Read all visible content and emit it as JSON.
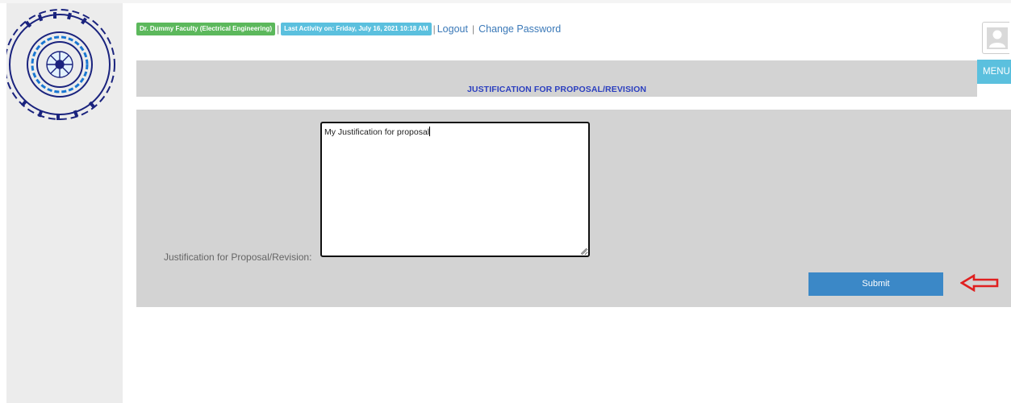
{
  "header": {
    "user_badge": "Dr. Dummy Faculty (Electrical Engineering)",
    "activity_badge": "Last Activity on: Friday, July 16, 2021 10:18 AM",
    "separator": "|",
    "logout_label": "Logout",
    "link_separator": "|",
    "change_password_label": "Change Password",
    "menu_label": "MENU"
  },
  "page": {
    "title": "JUSTIFICATION FOR PROPOSAL/REVISION"
  },
  "form": {
    "justification_label": "Justification for Proposal/Revision:",
    "justification_value": "My Justification for proposal",
    "submit_label": "Submit"
  },
  "colors": {
    "badge_green": "#5cb85c",
    "badge_blue": "#5bc0de",
    "title_text": "#2b3fbf",
    "submit_button": "#3b88c7",
    "annotation_arrow": "#e02020"
  },
  "icons": {
    "logo": "iit-roorkee-logo-icon",
    "avatar": "user-avatar-icon",
    "annotation": "red-left-arrow-icon"
  }
}
